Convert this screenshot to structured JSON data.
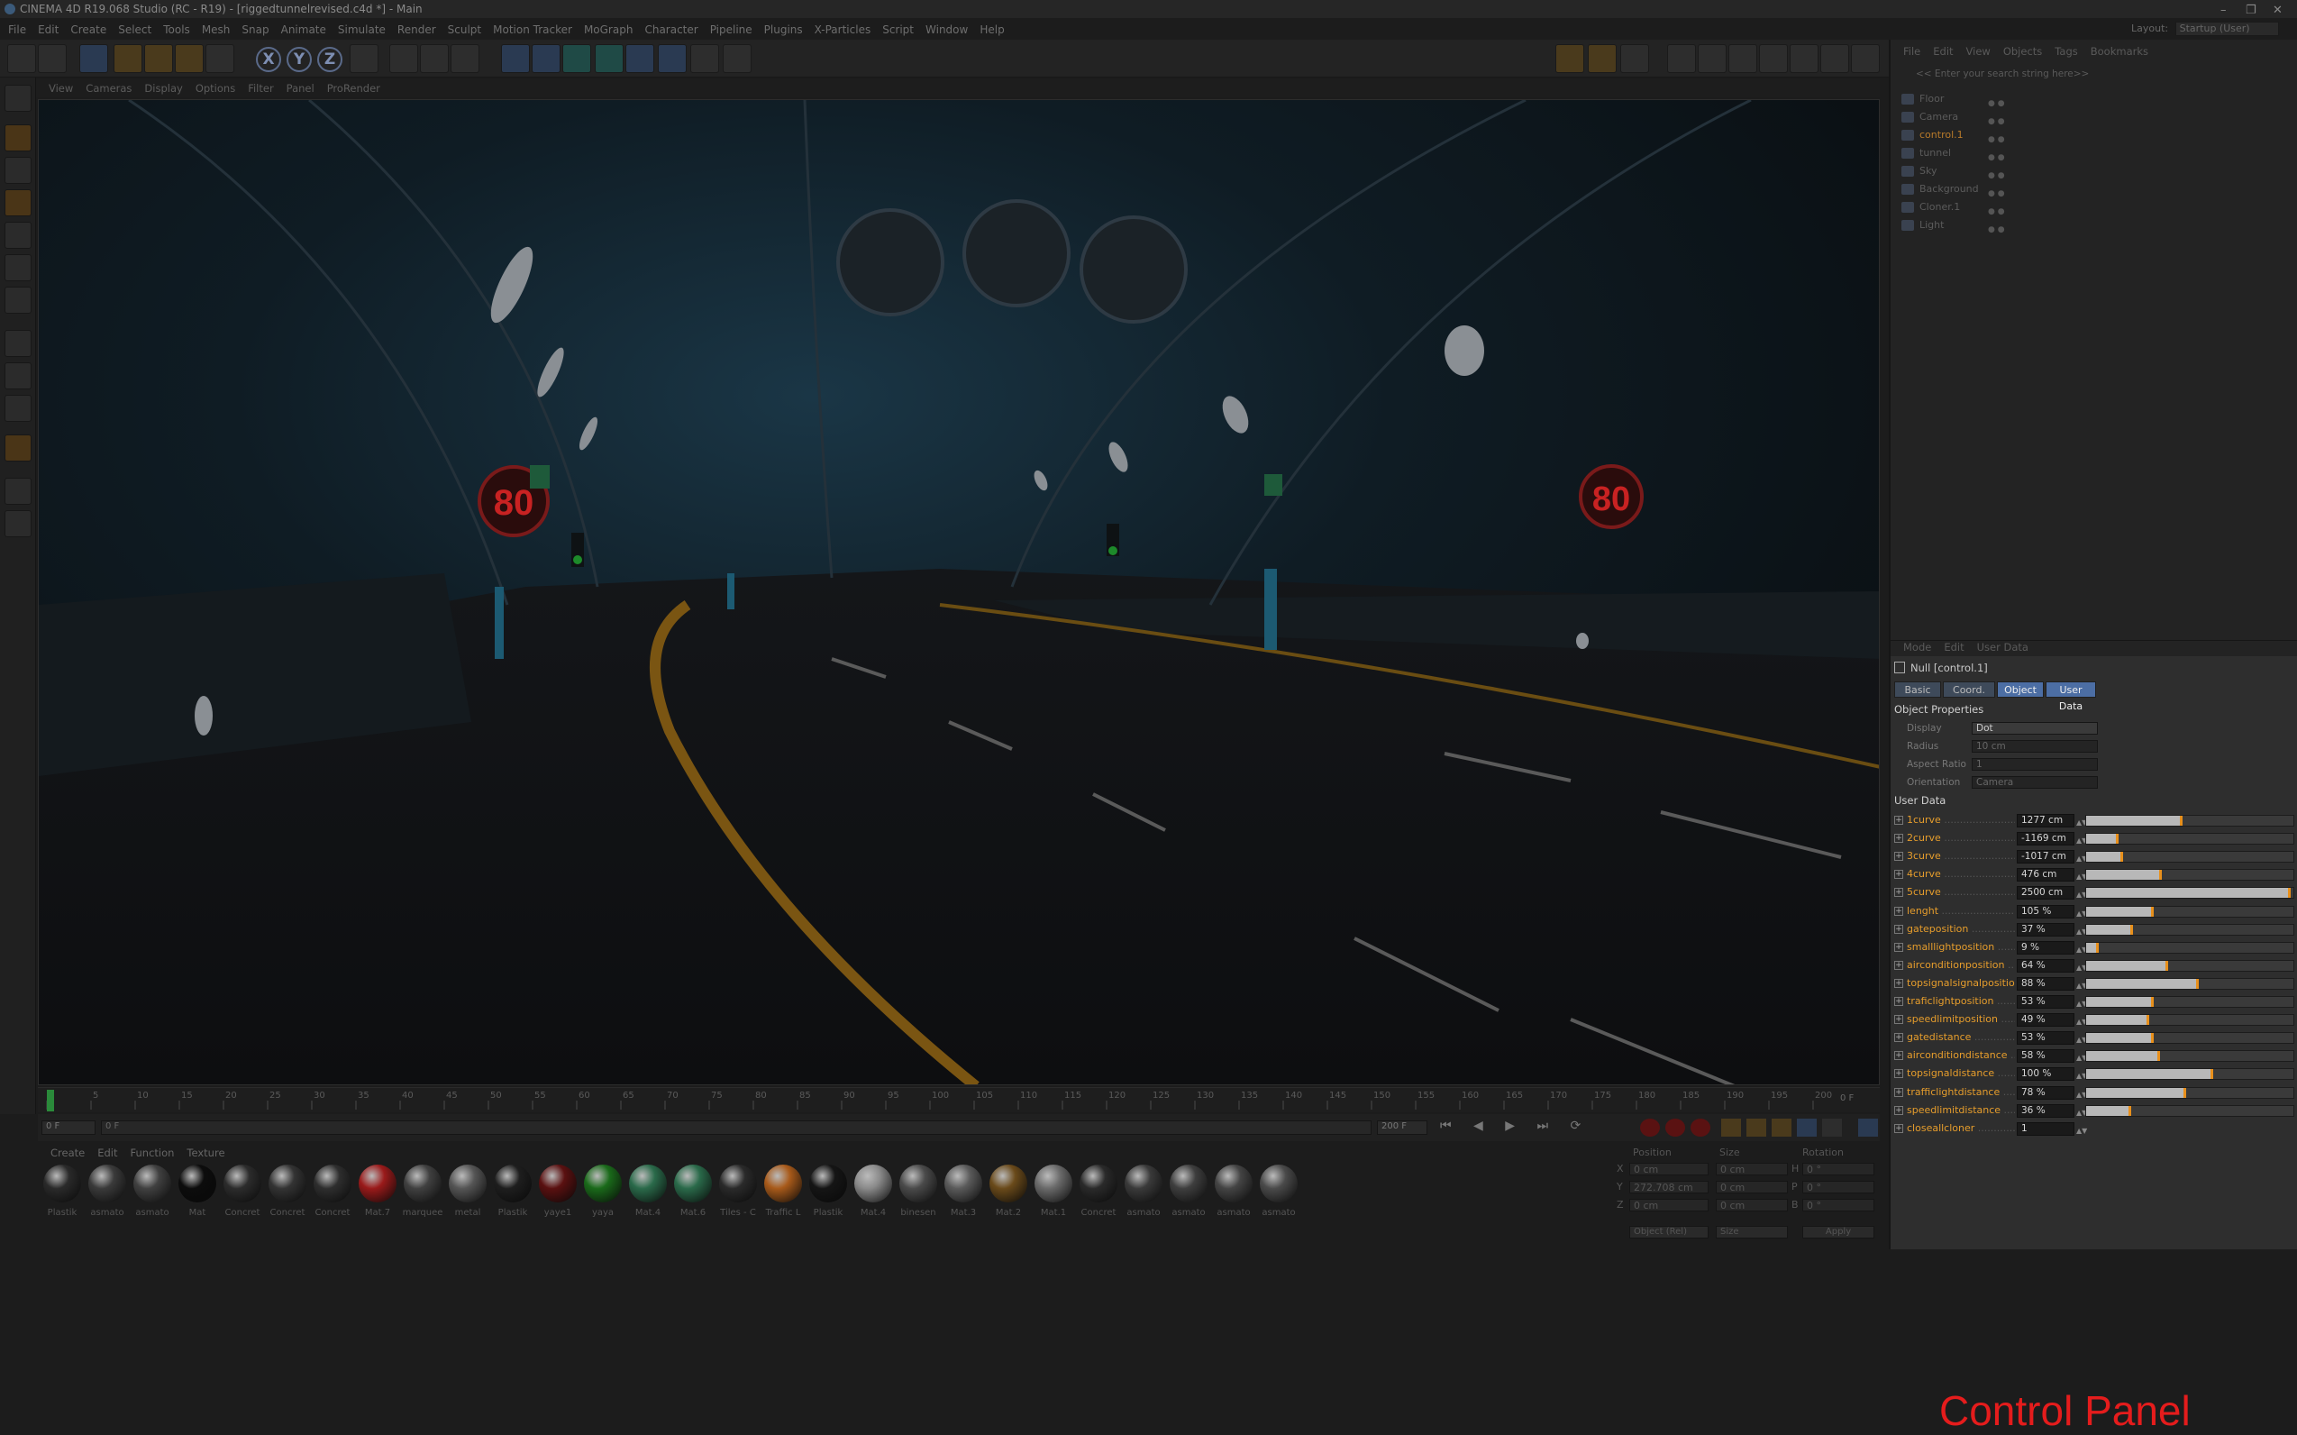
{
  "window": {
    "title": "CINEMA 4D R19.068 Studio (RC - R19) - [riggedtunnelrevised.c4d *] - Main",
    "layout_label": "Layout:",
    "layout_value": "Startup (User)"
  },
  "menu": [
    "File",
    "Edit",
    "Create",
    "Select",
    "Tools",
    "Mesh",
    "Snap",
    "Animate",
    "Simulate",
    "Render",
    "Sculpt",
    "Motion Tracker",
    "MoGraph",
    "Character",
    "Pipeline",
    "Plugins",
    "X-Particles",
    "Script",
    "Window",
    "Help"
  ],
  "viewport_menu": [
    "View",
    "Cameras",
    "Display",
    "Options",
    "Filter",
    "Panel",
    "ProRender"
  ],
  "scene": {
    "speed_sign_left": "80",
    "speed_sign_right": "80"
  },
  "timeline": {
    "ticks": [
      "0",
      "5",
      "10",
      "15",
      "20",
      "25",
      "30",
      "35",
      "40",
      "45",
      "50",
      "55",
      "60",
      "65",
      "70",
      "75",
      "80",
      "85",
      "90",
      "95",
      "100",
      "105",
      "110",
      "115",
      "120",
      "125",
      "130",
      "135",
      "140",
      "145",
      "150",
      "155",
      "160",
      "165",
      "170",
      "175",
      "180",
      "185",
      "190",
      "195",
      "200"
    ],
    "current": "0 F",
    "start": "0 F",
    "end": "200 F",
    "end_marker": "0 F"
  },
  "material_menu": [
    "Create",
    "Edit",
    "Function",
    "Texture"
  ],
  "materials": [
    {
      "name": "Plastik",
      "color": "#2a2a2a"
    },
    {
      "name": "asmato",
      "color": "#3a3a3a"
    },
    {
      "name": "asmato",
      "color": "#404040"
    },
    {
      "name": "Mat",
      "color": "#0c0c0c"
    },
    {
      "name": "Concret",
      "color": "#2c2c2c"
    },
    {
      "name": "Concret",
      "color": "#333333"
    },
    {
      "name": "Concret",
      "color": "#2e2e2e"
    },
    {
      "name": "Mat.7",
      "color": "#9a1a1a"
    },
    {
      "name": "marquee",
      "color": "#404040"
    },
    {
      "name": "metal",
      "color": "#555555"
    },
    {
      "name": "Plastik",
      "color": "#1e1e1e"
    },
    {
      "name": "yaye1",
      "color": "#5a1010"
    },
    {
      "name": "yaya",
      "color": "#1a6a1a"
    },
    {
      "name": "Mat.4",
      "color": "#2a6a4a"
    },
    {
      "name": "Mat.6",
      "color": "#2a6a4a"
    },
    {
      "name": "Tiles - C",
      "color": "#2a2a2a"
    },
    {
      "name": "Traffic L",
      "color": "#a85a1a"
    },
    {
      "name": "Plastik",
      "color": "#151515"
    },
    {
      "name": "Mat.4",
      "color": "#8a8a8a"
    },
    {
      "name": "binesen",
      "color": "#4a4a4a"
    },
    {
      "name": "Mat.3",
      "color": "#5a5a5a"
    },
    {
      "name": "Mat.2",
      "color": "#6a4a1a"
    },
    {
      "name": "Mat.1",
      "color": "#6a6a6a"
    },
    {
      "name": "Concret",
      "color": "#2a2a2a"
    },
    {
      "name": "asmato",
      "color": "#3a3a3a"
    },
    {
      "name": "asmato",
      "color": "#3e3e3e"
    },
    {
      "name": "asmato",
      "color": "#444444"
    },
    {
      "name": "asmato",
      "color": "#4a4a4a"
    }
  ],
  "coords": {
    "h_position": "Position",
    "h_size": "Size",
    "h_rotation": "Rotation",
    "rows": [
      {
        "a": "X",
        "pos": "0 cm",
        "size": "0 cm",
        "r": "H",
        "rot": "0 °"
      },
      {
        "a": "Y",
        "pos": "272.708 cm",
        "size": "0 cm",
        "r": "P",
        "rot": "0 °"
      },
      {
        "a": "Z",
        "pos": "0 cm",
        "size": "0 cm",
        "r": "B",
        "rot": "0 °"
      }
    ],
    "mode": "Object (Rel)",
    "sizemode": "Size",
    "apply": "Apply"
  },
  "object_menu": [
    "File",
    "Edit",
    "View",
    "Objects",
    "Tags",
    "Bookmarks"
  ],
  "search_placeholder": "<< Enter your search string here>>",
  "objects": [
    {
      "name": "Floor"
    },
    {
      "name": "Camera"
    },
    {
      "name": "control.1"
    },
    {
      "name": "tunnel"
    },
    {
      "name": "Sky"
    },
    {
      "name": "Background"
    },
    {
      "name": "Cloner.1"
    },
    {
      "name": "Light"
    }
  ],
  "attr_menu": [
    "Mode",
    "Edit",
    "User Data"
  ],
  "attr": {
    "title": "Null [control.1]",
    "tabs": [
      "Basic",
      "Coord.",
      "Object",
      "User Data"
    ],
    "section_obj": "Object Properties",
    "props": [
      {
        "label": "Display",
        "value": "Dot"
      },
      {
        "label": "Radius",
        "value": "10 cm"
      },
      {
        "label": "Aspect Ratio",
        "value": "1"
      },
      {
        "label": "Orientation",
        "value": "Camera"
      }
    ],
    "section_ud": "User Data",
    "userdata": [
      {
        "label": "1curve",
        "value": "1277 cm",
        "fraction": 0.47
      },
      {
        "label": "2curve",
        "value": "-1169 cm",
        "fraction": 0.16
      },
      {
        "label": "3curve",
        "value": "-1017 cm",
        "fraction": 0.18
      },
      {
        "label": "4curve",
        "value": "476 cm",
        "fraction": 0.37
      },
      {
        "label": "5curve",
        "value": "2500 cm",
        "fraction": 1.0
      },
      {
        "label": "lenght",
        "value": "105 %",
        "fraction": 0.33
      },
      {
        "label": "gateposition",
        "value": "37 %",
        "fraction": 0.23
      },
      {
        "label": "smalllightposition",
        "value": "9 %",
        "fraction": 0.06
      },
      {
        "label": "airconditionposition",
        "value": "64 %",
        "fraction": 0.4
      },
      {
        "label": "topsignalsignalposition",
        "value": "88 %",
        "fraction": 0.55
      },
      {
        "label": "traficlightposition",
        "value": "53 %",
        "fraction": 0.33
      },
      {
        "label": "speedlimitposition",
        "value": "49 %",
        "fraction": 0.31
      },
      {
        "label": "gatedistance",
        "value": "53 %",
        "fraction": 0.33
      },
      {
        "label": "airconditiondistance",
        "value": "58 %",
        "fraction": 0.36
      },
      {
        "label": "topsignaldistance",
        "value": "100 %",
        "fraction": 0.62
      },
      {
        "label": "trafficlightdistance",
        "value": "78 %",
        "fraction": 0.49
      },
      {
        "label": "speedlimitdistance",
        "value": "36 %",
        "fraction": 0.22
      },
      {
        "label": "closeallcloner",
        "value": "1"
      }
    ]
  },
  "annotation": "Control Panel"
}
